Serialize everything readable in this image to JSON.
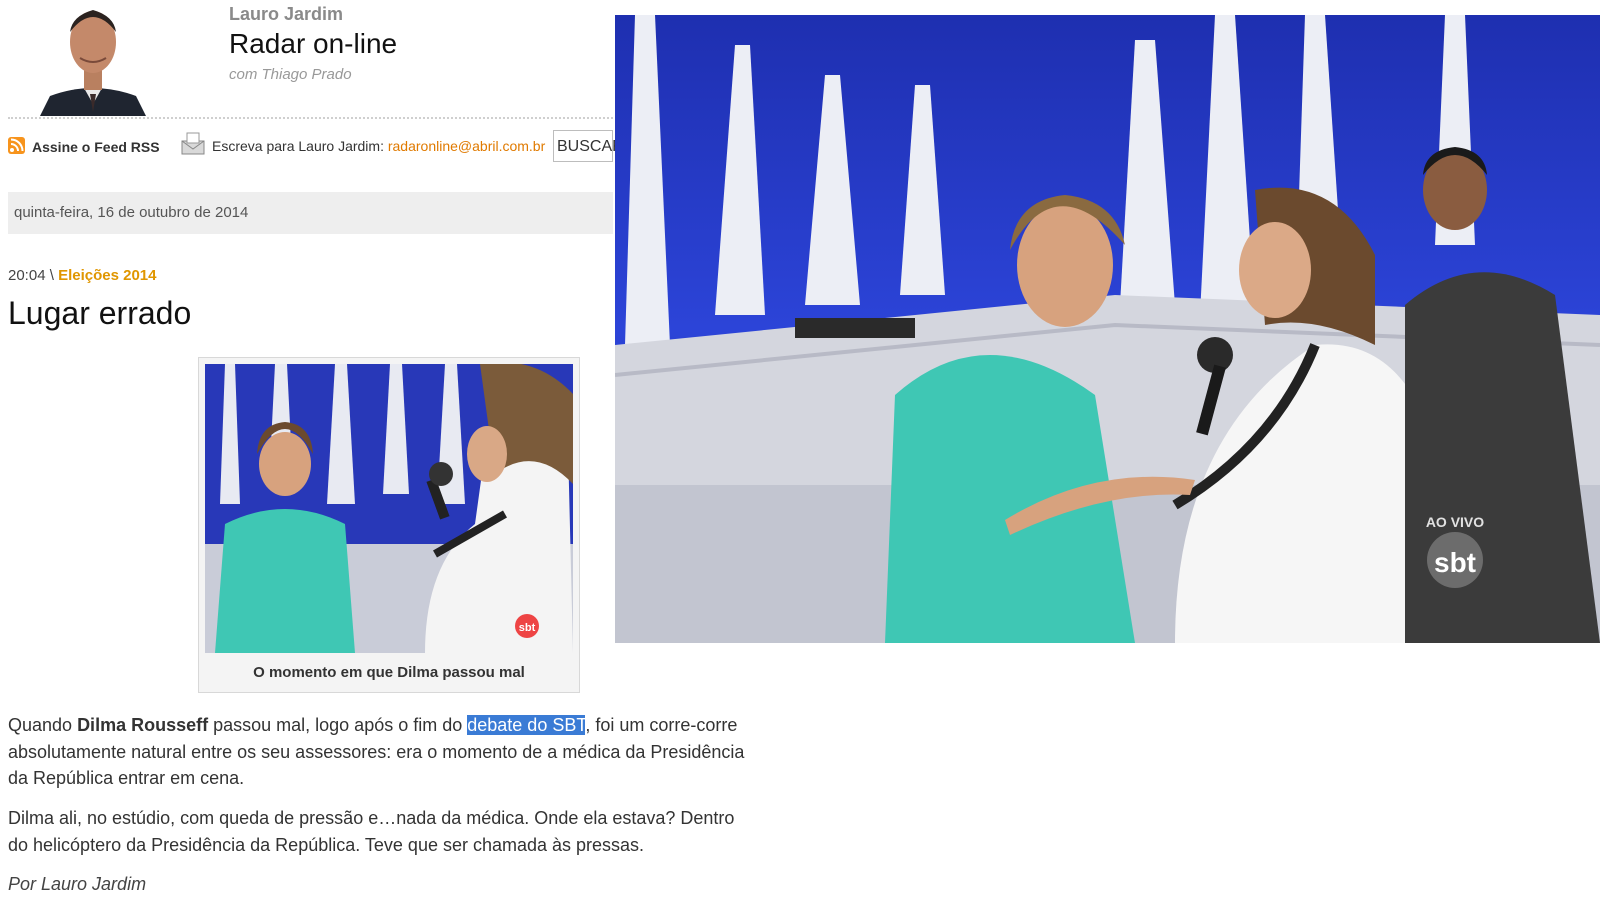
{
  "header": {
    "author": "Lauro Jardim",
    "blog_title": "Radar on-line",
    "subtitle": "com Thiago Prado"
  },
  "toolbar": {
    "rss_label": "Assine o Feed RSS",
    "write_label": "Escreva para Lauro Jardim: ",
    "write_email": "radaronline@abril.com.br",
    "search_label": "BUSCAR"
  },
  "date_bar": "quinta-feira, 16 de outubro de 2014",
  "post": {
    "time": "20:04",
    "separator": " \\ ",
    "category": "Eleições 2014",
    "title": "Lugar errado",
    "figure_caption": "O momento em que Dilma passou mal",
    "p1_a": "Quando ",
    "p1_bold": "Dilma Rousseff",
    "p1_b": " passou mal, logo após o fim do ",
    "p1_link": "debate do SBT",
    "p1_c": ", foi um corre-corre absolutamente natural entre os seu assessores: era o momento de a médica da Presidência da República entrar em cena.",
    "p2": "Dilma ali, no estúdio, com queda de pressão e…nada da médica. Onde ela estava?  Dentro do helicóptero da Presidência da República. Teve que ser chamada às pressas.",
    "byline": "Por Lauro Jardim"
  },
  "video": {
    "live_badge": "AO VIVO",
    "channel_logo": "sbt"
  },
  "figure_logo": "sbt",
  "colors": {
    "accent_orange": "#e09600",
    "link_highlight": "#3a7bd5",
    "jacket_teal": "#3fc7b4",
    "studio_blue": "#1e2fb0"
  }
}
